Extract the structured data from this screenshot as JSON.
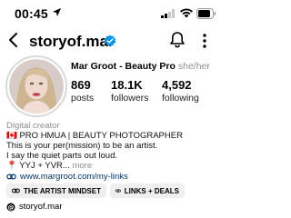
{
  "status_bar": {
    "time": "00:45"
  },
  "header": {
    "username": "storyof.mar"
  },
  "profile": {
    "display_name": "Mar Groot - Beauty Pro",
    "pronouns": "she/her",
    "stats": [
      {
        "value": "869",
        "label": "posts"
      },
      {
        "value": "18.1K",
        "label": "followers"
      },
      {
        "value": "4,592",
        "label": "following"
      }
    ],
    "category": "Digital creator",
    "bio_lines": [
      "🇨🇦 PRO HMUA | BEAUTY PHOTOGRAPHER",
      "This is your per(mission) to be an artist.",
      "I say the quiet parts out loud."
    ],
    "bio_location": "📍 YYJ + YVR...",
    "bio_more": "more",
    "link": "www.margroot.com/my-links"
  },
  "chips": [
    {
      "label": "THE ARTIST MINDSET"
    },
    {
      "label": "LINKS + DEALS"
    }
  ],
  "threads": {
    "label": "storyof.mar"
  },
  "colors": {
    "verified": "#0095f6",
    "link": "#00376b",
    "chip_bg": "#efefef"
  }
}
